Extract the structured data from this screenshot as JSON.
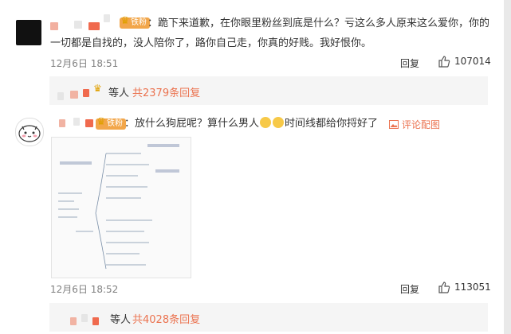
{
  "comments": [
    {
      "badge": "铁粉",
      "text_line1": "：跪下来道歉，在你眼里粉丝到底是什么？亏这么多人原来这么爱你，你的",
      "text_line2": "一切都是自找的，没人陪你了，路你自己走，你真的好贱。我好恨你。",
      "time": "12月6日 18:51",
      "reply_label": "回复",
      "likes": "107014",
      "replies_etc": "等人",
      "replies_count": "共2379条回复"
    },
    {
      "badge": "铁粉",
      "text_part1": "：放什么狗屁呢？算什么男人",
      "text_part2": "时间线都给你捋好了",
      "pic_link": "评论配图",
      "time": "12月6日 18:52",
      "reply_label": "回复",
      "likes": "113051",
      "replies_etc": "等人",
      "replies_count": "共4028条回复"
    }
  ],
  "colors": {
    "accent": "#eb7350",
    "badge_bg": "#f2a64a",
    "reply_bg": "#f5f5f5"
  },
  "icons": [
    "thumbs-up-icon",
    "image-icon",
    "crown-icon",
    "emoji-icon"
  ]
}
